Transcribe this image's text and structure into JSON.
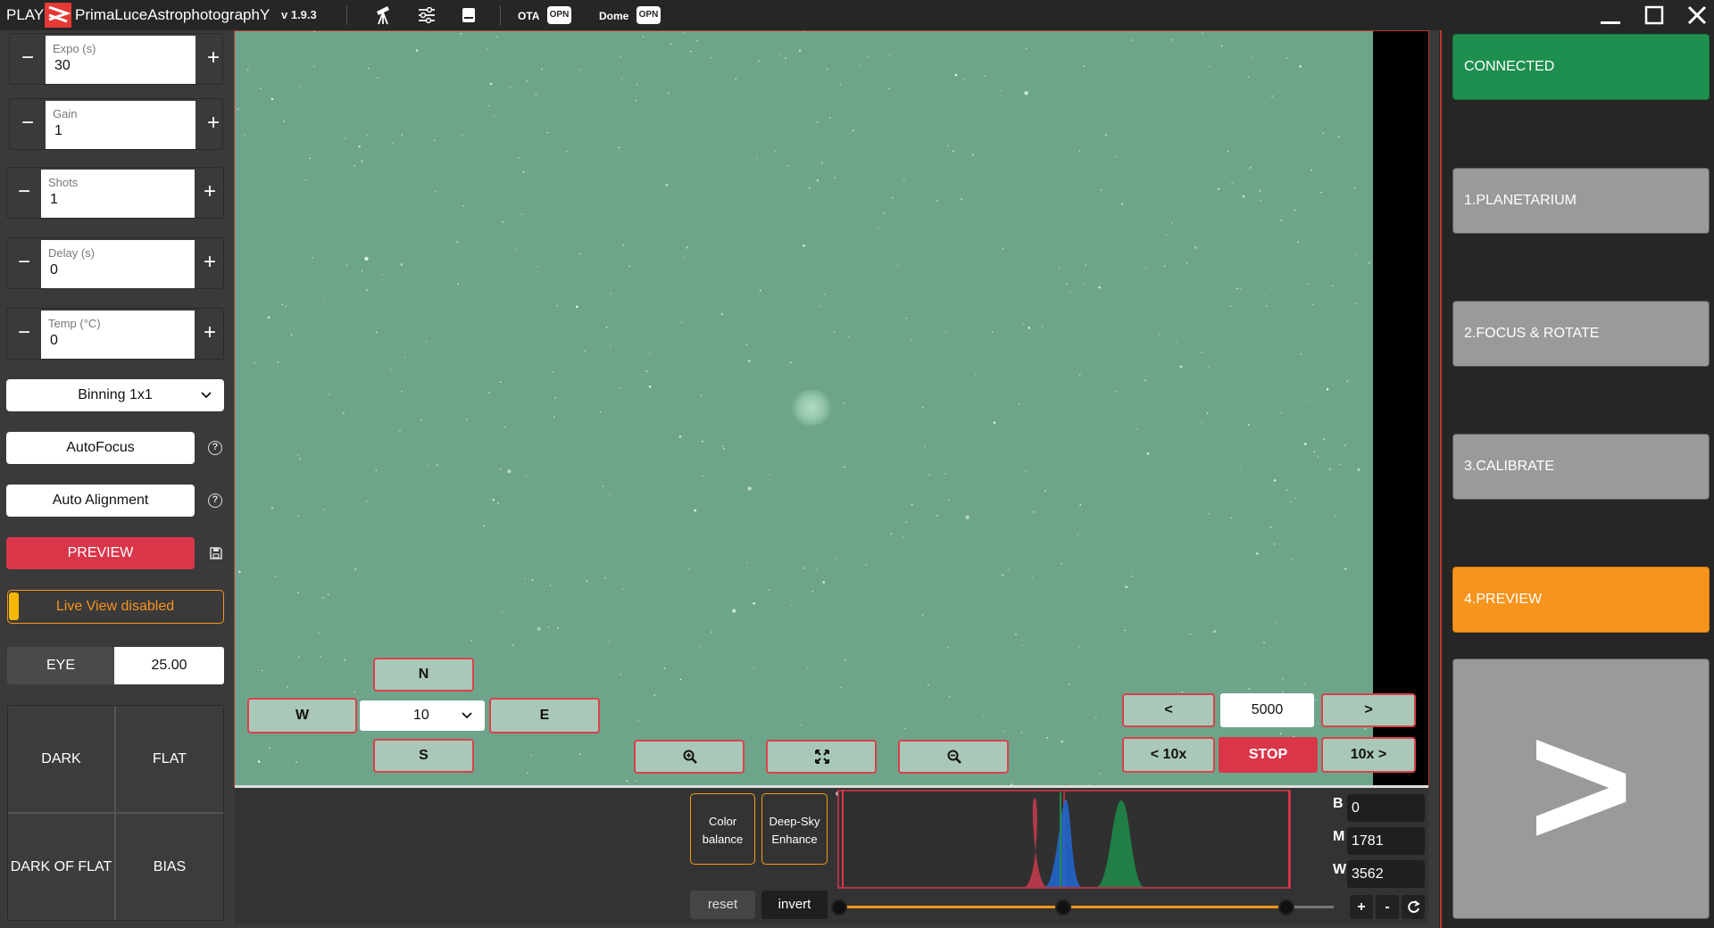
{
  "titlebar": {
    "play": "PLAY",
    "brand": "PrimaLuceAstrophotographY",
    "version": "v 1.9.3",
    "ota_label": "OTA",
    "ota_status": "OPN",
    "dome_label": "Dome",
    "dome_status": "OPN",
    "brand_color": "#e53935"
  },
  "controls": {
    "expo": {
      "label": "Expo (s)",
      "value": "30"
    },
    "gain": {
      "label": "Gain",
      "value": "1"
    },
    "shots": {
      "label": "Shots",
      "value": "1"
    },
    "delay": {
      "label": "Delay (s)",
      "value": "0"
    },
    "temp": {
      "label": "Temp (°C)",
      "value": "0"
    },
    "binning": "Binning 1x1",
    "autofocus": "AutoFocus",
    "auto_alignment": "Auto Alignment",
    "preview": "PREVIEW",
    "live_view": "Live View disabled",
    "eye_label": "EYE",
    "eye_value": "25.00",
    "calib": {
      "dark": "DARK",
      "flat": "FLAT",
      "dark_of_flat": "DARK OF FLAT",
      "bias": "BIAS"
    }
  },
  "nav": {
    "north": "N",
    "south": "S",
    "west": "W",
    "east": "E",
    "step": "10",
    "prev": "<",
    "next": ">",
    "prev10": "< 10x",
    "next10": "10x >",
    "frame": "5000",
    "stop": "STOP"
  },
  "histogram": {
    "color_balance": "Color balance",
    "deep_sky": "Deep-Sky Enhance",
    "reset": "reset",
    "invert": "invert",
    "b_label": "B",
    "b_value": "0",
    "m_label": "M",
    "m_value": "1781",
    "w_label": "W",
    "w_value": "3562",
    "plus": "+",
    "minus": "-"
  },
  "steps": {
    "connected": "CONNECTED",
    "planetarium": "1.PLANETARIUM",
    "focus": "2.FOCUS & ROTATE",
    "calibrate": "3.CALIBRATE",
    "preview": "4.PREVIEW",
    "next": ">"
  },
  "colors": {
    "connected": "#1e8f4e",
    "active_step": "#f7941d",
    "stop": "#d9364a",
    "sky": "#6ea48a"
  }
}
